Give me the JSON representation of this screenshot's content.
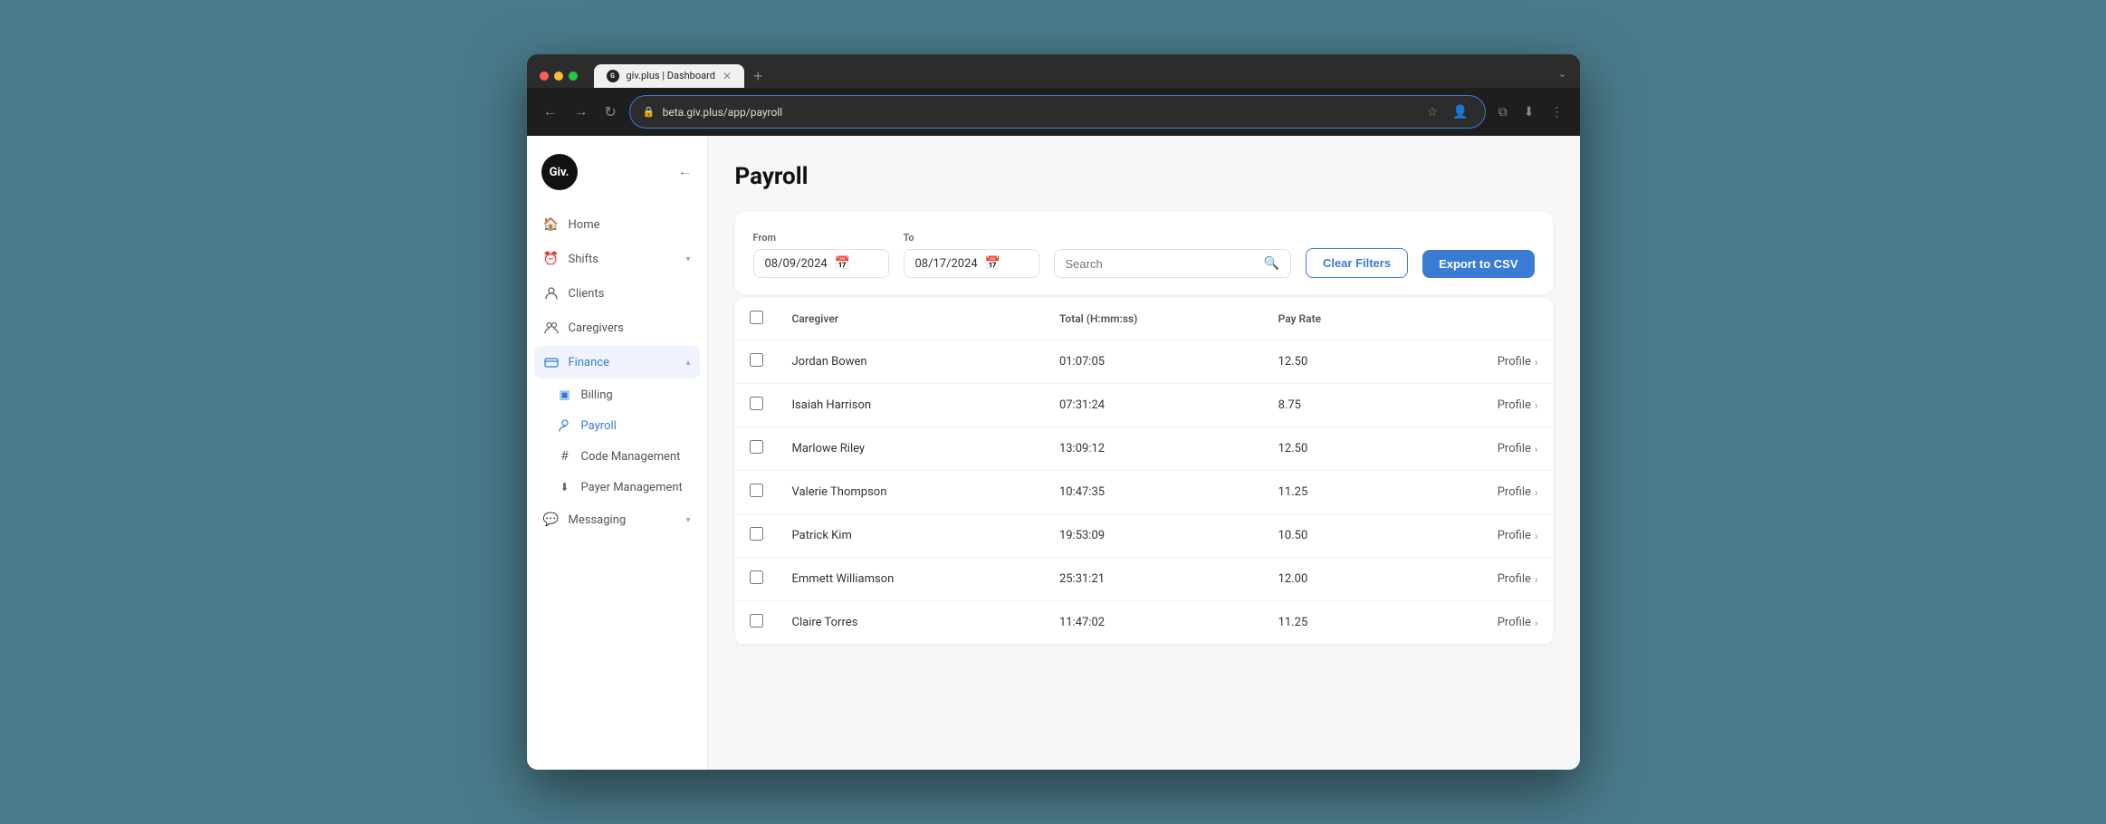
{
  "browser": {
    "url": "beta.giv.plus/app/payroll",
    "tab_title": "giv.plus | Dashboard",
    "tab_add": "+",
    "nav": {
      "back": "←",
      "forward": "→",
      "refresh": "↻"
    }
  },
  "sidebar": {
    "logo_text": "Giv.",
    "collapse_icon": "←",
    "items": [
      {
        "id": "home",
        "label": "Home",
        "icon": "🏠",
        "active": false
      },
      {
        "id": "shifts",
        "label": "Shifts",
        "icon": "⏰",
        "active": false,
        "has_chevron": true,
        "chevron_dir": "down"
      },
      {
        "id": "clients",
        "label": "Clients",
        "icon": "👤",
        "active": false
      },
      {
        "id": "caregivers",
        "label": "Caregivers",
        "icon": "👥",
        "active": false
      },
      {
        "id": "finance",
        "label": "Finance",
        "icon": "💳",
        "active": true,
        "has_chevron": true,
        "chevron_dir": "up"
      }
    ],
    "subitems": [
      {
        "id": "billing",
        "label": "Billing",
        "icon": "▣",
        "active": false
      },
      {
        "id": "payroll",
        "label": "Payroll",
        "icon": "👤",
        "active": true
      },
      {
        "id": "code-management",
        "label": "Code Management",
        "icon": "#",
        "active": false
      },
      {
        "id": "payer-management",
        "label": "Payer Management",
        "icon": "⬇",
        "active": false
      }
    ],
    "bottom_items": [
      {
        "id": "messaging",
        "label": "Messaging",
        "icon": "💬",
        "has_chevron": true
      }
    ]
  },
  "page": {
    "title": "Payroll",
    "filters": {
      "from_label": "From",
      "from_value": "08/09/2024",
      "to_label": "To",
      "to_value": "08/17/2024",
      "search_placeholder": "Search",
      "clear_filters_label": "Clear Filters",
      "export_label": "Export to CSV"
    },
    "table": {
      "columns": [
        "Caregiver",
        "Total (H:mm:ss)",
        "Pay Rate",
        ""
      ],
      "rows": [
        {
          "name": "Jordan Bowen",
          "total": "01:07:05",
          "pay_rate": "12.50",
          "profile_link": "Profile"
        },
        {
          "name": "Isaiah Harrison",
          "total": "07:31:24",
          "pay_rate": "8.75",
          "profile_link": "Profile"
        },
        {
          "name": "Marlowe Riley",
          "total": "13:09:12",
          "pay_rate": "12.50",
          "profile_link": "Profile"
        },
        {
          "name": "Valerie Thompson",
          "total": "10:47:35",
          "pay_rate": "11.25",
          "profile_link": "Profile"
        },
        {
          "name": "Patrick Kim",
          "total": "19:53:09",
          "pay_rate": "10.50",
          "profile_link": "Profile"
        },
        {
          "name": "Emmett Williamson",
          "total": "25:31:21",
          "pay_rate": "12.00",
          "profile_link": "Profile"
        },
        {
          "name": "Claire Torres",
          "total": "11:47:02",
          "pay_rate": "11.25",
          "profile_link": "Profile"
        }
      ]
    }
  }
}
